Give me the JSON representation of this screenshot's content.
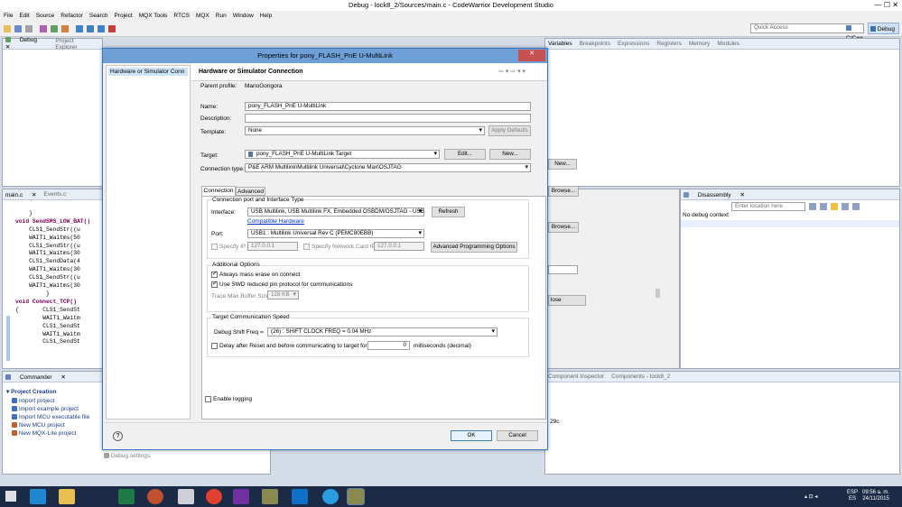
{
  "window": {
    "title": "Debug - lock8_2/Sources/main.c - CodeWarrior Development Studio"
  },
  "menu": [
    "File",
    "Edit",
    "Source",
    "Refactor",
    "Search",
    "Project",
    "MQX Tools",
    "RTCS",
    "MQX",
    "Run",
    "Window",
    "Help"
  ],
  "toolbar": {
    "quick_access": "Quick Access",
    "perspective_cpp": "C/C++",
    "perspective_debug": "Debug"
  },
  "debug_view": {
    "tab_debug": "Debug",
    "tab_project_explorer": "Project Explorer"
  },
  "variables_view": {
    "tabs": [
      "Variables",
      "Breakpoints",
      "Expressions",
      "Registers",
      "Memory",
      "Modules"
    ]
  },
  "editor": {
    "tabs": [
      "main.c",
      "Events.c"
    ],
    "lines": [
      "    }",
      "",
      "void SendSMS_LOW_BAT()",
      "    CLS1_SendStr((u",
      "    WAIT1_Waitms(50",
      "    CLS1_SendStr((u",
      "    WAIT1_Waitms(30",
      "    CLS1_SendData(4",
      "    WAIT1_Waitms(30",
      "    CLS1_SendStr((u",
      "    WAIT1_Waitms(30",
      "         }",
      "",
      "void Connect_TCP()",
      "{       CLS1_SendSt",
      "        WAIT1_Waitm",
      "        CLS1_SendSt",
      "        WAIT1_Waitm",
      "        CLS1_SendSt"
    ]
  },
  "disassembly": {
    "tab": "Disassembly",
    "location_placeholder": "Enter location here",
    "no_context": "No debug context"
  },
  "commander": {
    "tab": "Commander",
    "section": "Project Creation",
    "items": [
      "Import project",
      "Import example project",
      "Import MCU executable file",
      "New MCU project",
      "New MQX-Lite project"
    ],
    "debug_settings": "Debug settings"
  },
  "bottom_views": {
    "component_inspector": "Component Inspector",
    "components": "Components - lock8_2",
    "fragment": "29c"
  },
  "background_buttons": {
    "new": "New...",
    "browse1": "Browse...",
    "browse2": "Browse...",
    "close": "lose"
  },
  "dialog": {
    "title": "Properties for pony_FLASH_PnE U-MultiLink",
    "nav_item": "Hardware or Simulator Conn",
    "page_title": "Hardware or Simulator Connection",
    "parent_profile_label": "Parent profile:",
    "parent_profile_value": "MarioGongora",
    "name_label": "Name:",
    "name_value": "pony_FLASH_PnE U-MultiLink",
    "description_label": "Description:",
    "description_value": "",
    "template_label": "Template:",
    "template_value": "None",
    "apply_defaults": "Apply Defaults",
    "target_label": "Target:",
    "target_value": "pony_FLASH_PnE U-MultiLink Target",
    "edit_btn": "Edit...",
    "new_btn": "New...",
    "conn_type_label": "Connection type:",
    "conn_type_value": "P&E ARM Multilink\\Multilink Universal\\Cyclone Max\\OSJTAG",
    "tabs": [
      "Connection",
      "Advanced"
    ],
    "port_group": "Connection port and Interface Type",
    "interface_label": "Interface:",
    "interface_value": "USB Multilink, USB Multilink FX, Embedded OSBDM/OSJTAG - USB",
    "refresh_btn": "Refresh",
    "compatible_hw": "Compatible Hardware",
    "port_label": "Port:",
    "port_value": "USB1 : Multilink Universal Rev C (PEMC80EBB)",
    "specify_ip": "Specify IP",
    "ip1": "127.0.0.1",
    "specify_card_ip": "Specify Network Card IP",
    "ip2": "127.0.0.1",
    "adv_prog_options": "Advanced Programming Options",
    "additional_options": "Additional Options",
    "mass_erase": "Always mass erase on connect",
    "swd": "Use SWD reduced pin protocol for communications",
    "trace_label": "Trace Max Buffer Size:",
    "trace_value": "128 KB",
    "speed_group": "Target Communication Speed",
    "shift_label": "Debug Shift Freq =",
    "shift_value": "(26) : SHIFT CLOCK FREQ = 0.04 MHz",
    "delay_label": "Delay after Reset and before communicating to target for",
    "delay_value": "0",
    "delay_unit": "milliseconds (decimal)",
    "enable_logging": "Enable logging",
    "ok": "OK",
    "cancel": "Cancel"
  },
  "taskbar": {
    "lang1": "ESP",
    "lang2": "ES",
    "time": "09:56 a. m.",
    "date": "24/11/2015"
  }
}
